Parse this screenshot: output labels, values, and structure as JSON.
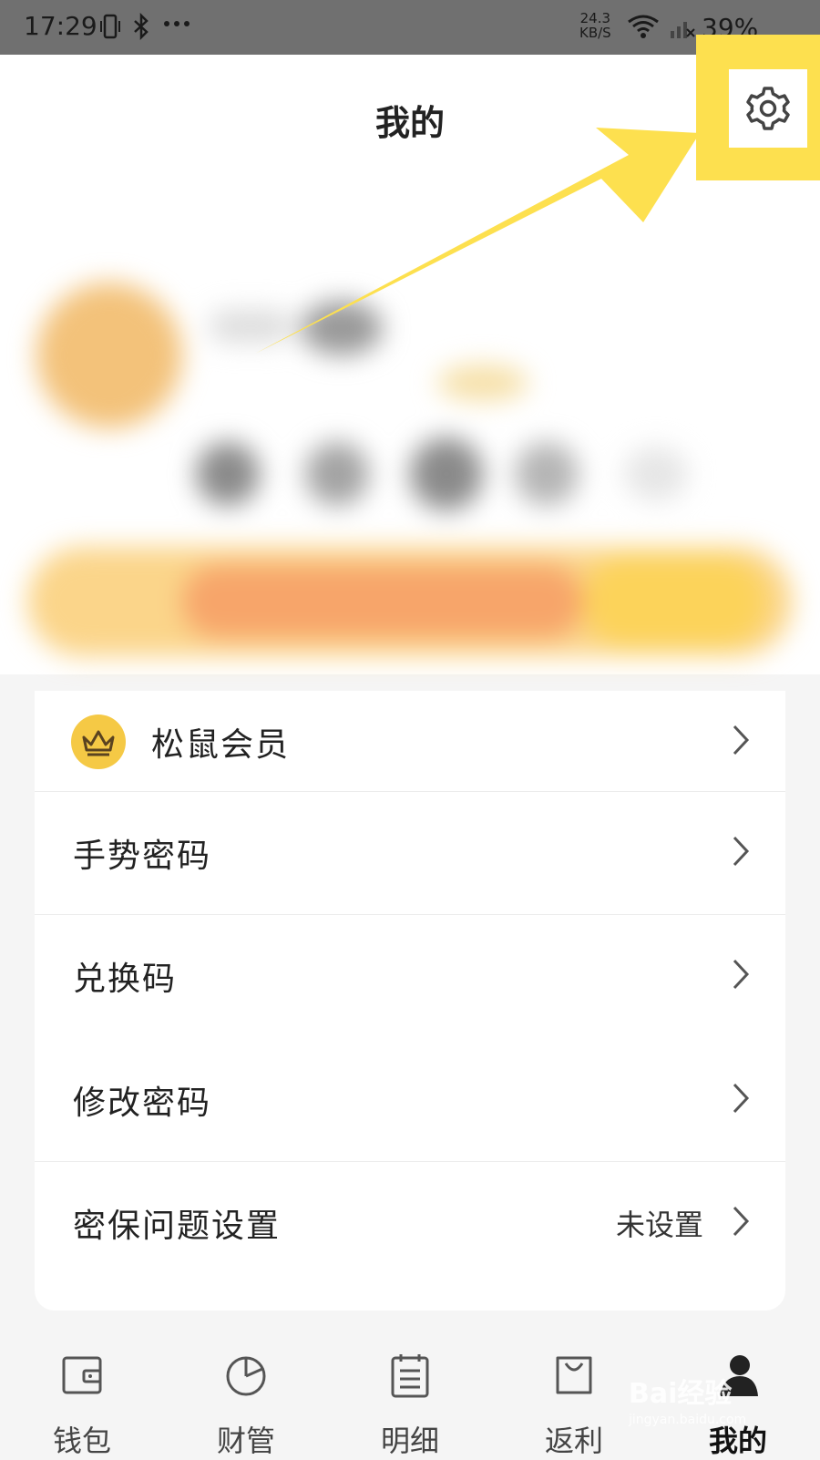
{
  "status_bar": {
    "time": "17:29",
    "speed_value": "24.3",
    "speed_unit": "KB/S",
    "battery": "39%"
  },
  "header": {
    "title": "我的",
    "settings_icon": "gear-icon",
    "highlight_color": "#fde04f"
  },
  "menu": {
    "items": [
      {
        "label": "松鼠会员",
        "icon": "crown-icon"
      },
      {
        "label": "手势密码"
      },
      {
        "label": "兑换码"
      },
      {
        "label": "修改密码"
      },
      {
        "label": "密保问题设置",
        "value": "未设置"
      }
    ]
  },
  "tabbar": {
    "tabs": [
      {
        "label": "钱包",
        "icon": "wallet-icon"
      },
      {
        "label": "财管",
        "icon": "pie-chart-icon"
      },
      {
        "label": "明细",
        "icon": "list-icon"
      },
      {
        "label": "返利",
        "icon": "shopping-bag-icon"
      },
      {
        "label": "我的",
        "icon": "user-icon",
        "active": true
      }
    ]
  },
  "watermark": {
    "brand": "Bai",
    "brand2": "经验",
    "url": "jingyan.baidu.com"
  }
}
